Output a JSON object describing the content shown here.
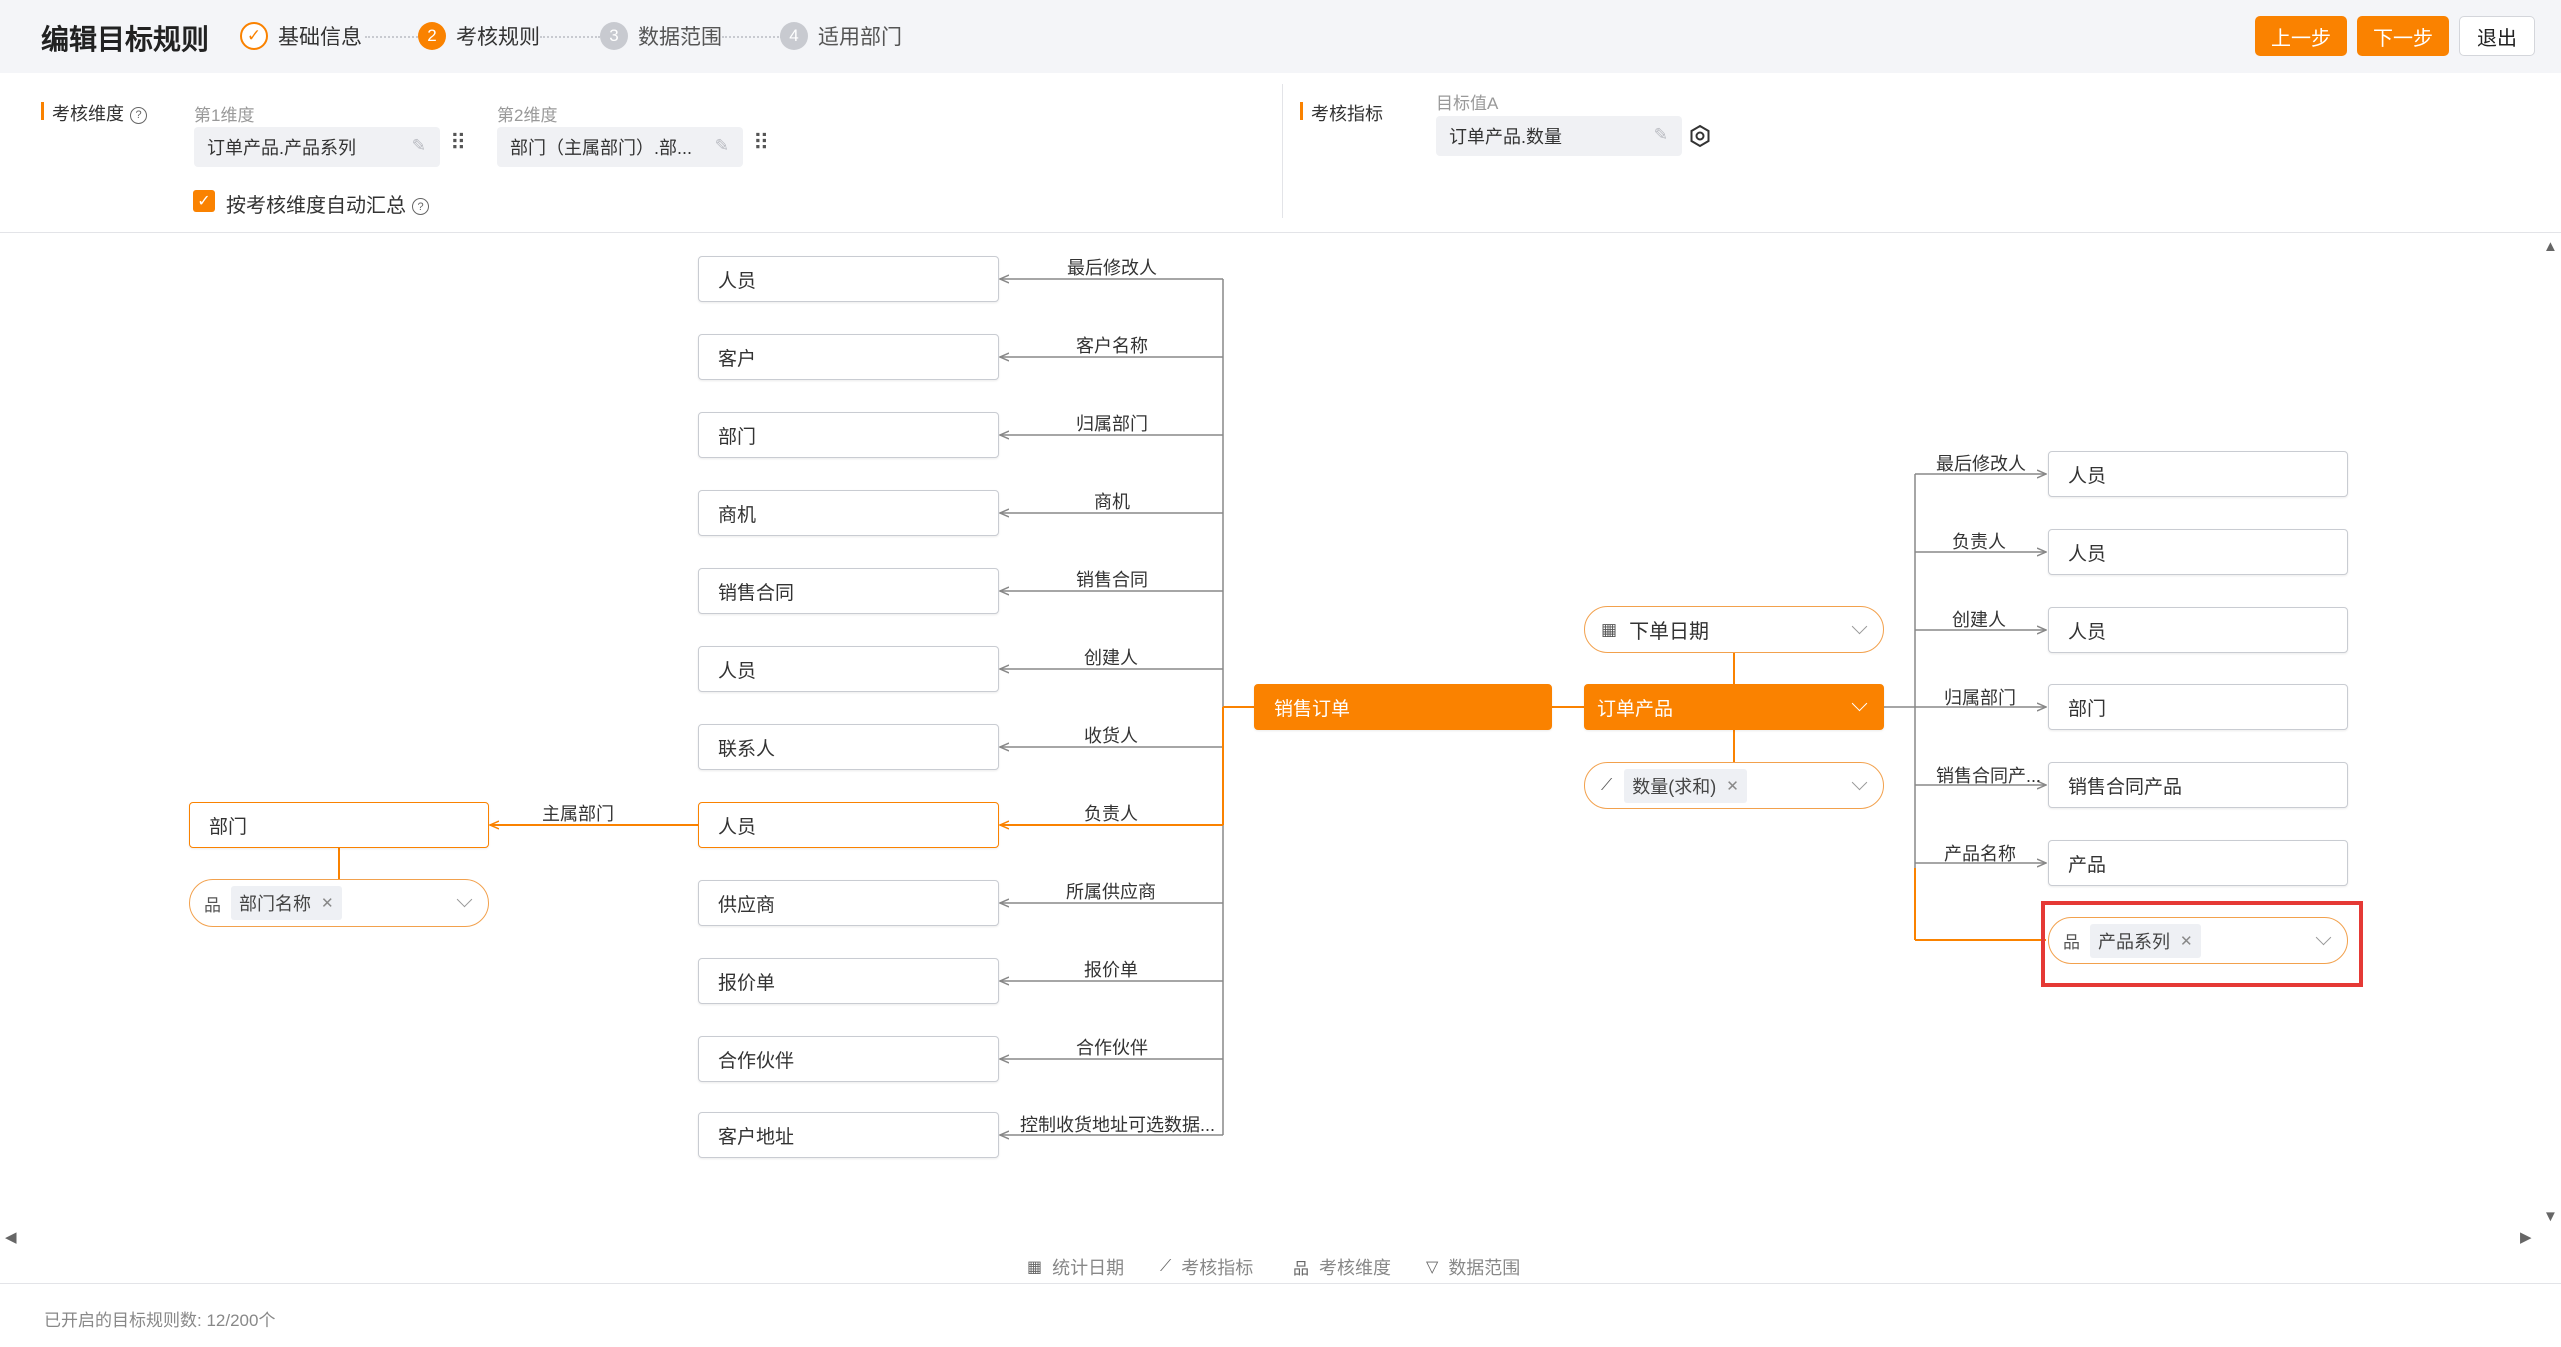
{
  "header": {
    "title": "编辑目标规则",
    "steps": [
      {
        "num": "✓",
        "label": "基础信息"
      },
      {
        "num": "2",
        "label": "考核规则"
      },
      {
        "num": "3",
        "label": "数据范围"
      },
      {
        "num": "4",
        "label": "适用部门"
      }
    ],
    "prev_label": "上一步",
    "next_label": "下一步",
    "exit_label": "退出"
  },
  "config": {
    "dimension_label": "考核维度",
    "dim1_label": "第1维度",
    "dim1_value": "订单产品.产品系列",
    "dim2_label": "第2维度",
    "dim2_value": "部门（主属部门）.部...",
    "auto_summary_label": "按考核维度自动汇总",
    "metric_label": "考核指标",
    "target_label": "目标值A",
    "target_value": "订单产品.数量"
  },
  "canvas": {
    "left_nodes": [
      {
        "label": "人员",
        "edge": "最后修改人"
      },
      {
        "label": "客户",
        "edge": "客户名称"
      },
      {
        "label": "部门",
        "edge": "归属部门"
      },
      {
        "label": "商机",
        "edge": "商机"
      },
      {
        "label": "销售合同",
        "edge": "销售合同"
      },
      {
        "label": "人员",
        "edge": "创建人"
      },
      {
        "label": "联系人",
        "edge": "收货人"
      },
      {
        "label": "人员",
        "edge": "负责人"
      },
      {
        "label": "供应商",
        "edge": "所属供应商"
      },
      {
        "label": "报价单",
        "edge": "报价单"
      },
      {
        "label": "合作伙伴",
        "edge": "合作伙伴"
      },
      {
        "label": "客户地址",
        "edge": "控制收货地址可选数据..."
      }
    ],
    "dept_node": {
      "label": "部门",
      "edge": "主属部门",
      "dim_tag": "部门名称"
    },
    "sales_order": "销售订单",
    "order_product": "订单产品",
    "order_date": "下单日期",
    "quantity_tag": "数量(求和)",
    "right_nodes": [
      {
        "label": "人员",
        "edge": "最后修改人"
      },
      {
        "label": "人员",
        "edge": "负责人"
      },
      {
        "label": "人员",
        "edge": "创建人"
      },
      {
        "label": "部门",
        "edge": "归属部门"
      },
      {
        "label": "销售合同产品",
        "edge": "销售合同产..."
      },
      {
        "label": "产品",
        "edge": "产品名称"
      }
    ],
    "product_series_tag": "产品系列"
  },
  "bottom_bar": {
    "items": [
      {
        "icon": "calendar-icon",
        "label": "统计日期"
      },
      {
        "icon": "line-chart-icon",
        "label": "考核指标"
      },
      {
        "icon": "hierarchy-icon",
        "label": "考核维度"
      },
      {
        "icon": "filter-icon",
        "label": "数据范围"
      }
    ]
  },
  "footer": {
    "text": "已开启的目标规则数: 12/200个"
  },
  "colors": {
    "accent": "#fa8200",
    "highlight": "#e53935"
  }
}
